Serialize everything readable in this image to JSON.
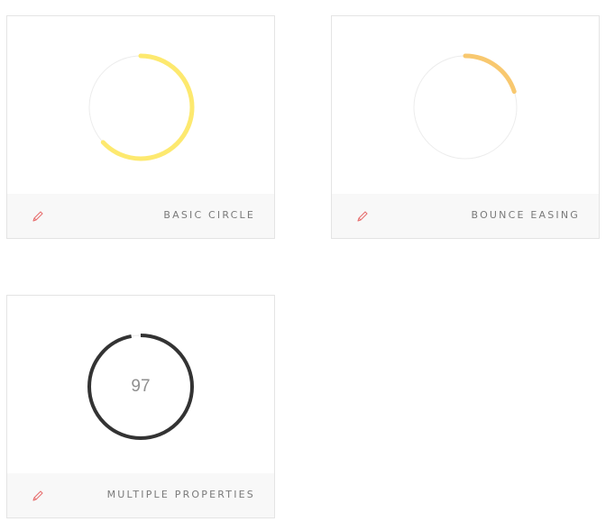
{
  "cards": [
    {
      "title": "BASIC CIRCLE",
      "progress": 0.63,
      "track_color": "#ececec",
      "bar_color": "#fde96f",
      "edit_icon": "pencil-icon"
    },
    {
      "title": "BOUNCE EASING",
      "progress": 0.2,
      "track_color": "#ececec",
      "bar_color": "#f8c86f",
      "edit_icon": "pencil-icon"
    },
    {
      "title": "MULTIPLE PROPERTIES",
      "progress": 0.97,
      "value_text": "97",
      "track_color": "#ececec",
      "bar_color": "#333333",
      "edit_icon": "pencil-icon"
    }
  ],
  "colors": {
    "edit_icon": "#e76f6f"
  }
}
